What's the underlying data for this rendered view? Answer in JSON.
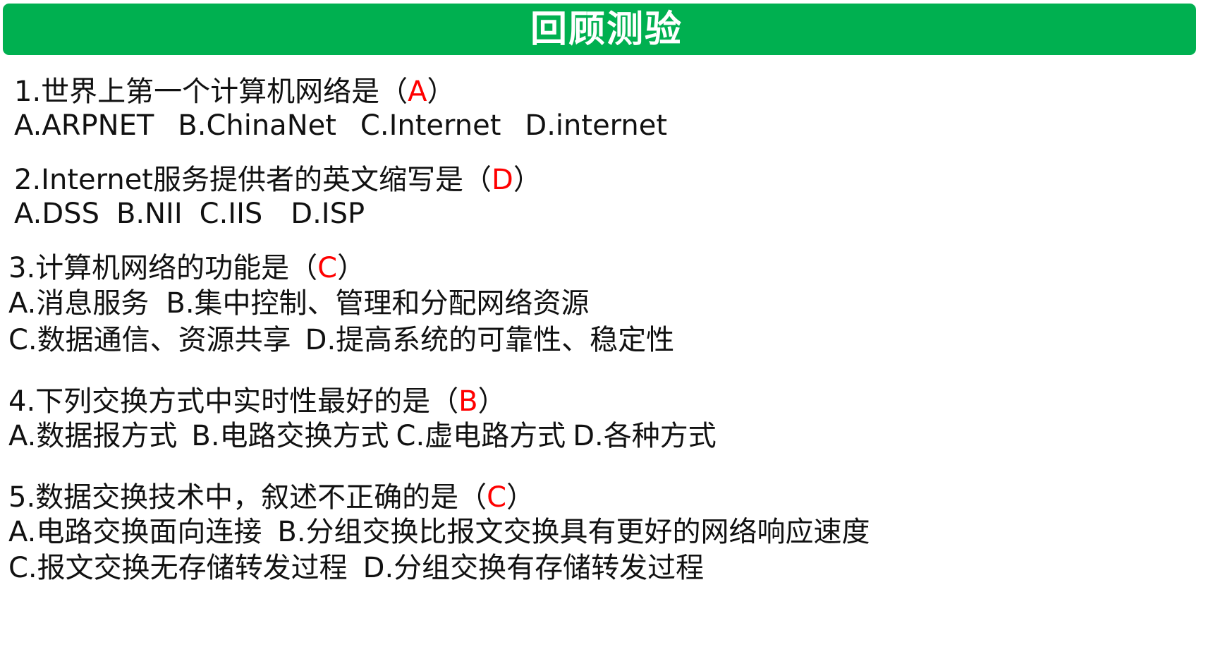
{
  "title": "回顾测验",
  "colors": {
    "header_bg": "#00b050",
    "header_text": "#ffffff",
    "answer": "#ff0000",
    "body_text": "#111111"
  },
  "questions": [
    {
      "stem": "1.世界上第一个计算机网络是（",
      "answer": "A",
      "close": "）",
      "options": [
        "A.ARPNET",
        "B.ChinaNet",
        "C.Internet",
        "D.internet"
      ]
    },
    {
      "stem": "2.Internet服务提供者的英文缩写是（",
      "answer": "D",
      "close": "）",
      "options": [
        "A.DSS",
        "B.NII",
        "C.IIS",
        "D.ISP"
      ]
    },
    {
      "stem": "3.计算机网络的功能是（",
      "answer": "C",
      "close": "）",
      "options": [
        "A.消息服务",
        "B.集中控制、管理和分配网络资源",
        "C.数据通信、资源共享",
        "D.提高系统的可靠性、稳定性"
      ]
    },
    {
      "stem": "4.下列交换方式中实时性最好的是（",
      "answer": "B",
      "close": "）",
      "options": [
        "A.数据报方式",
        "B.电路交换方式",
        "C.虚电路方式",
        "D.各种方式"
      ]
    },
    {
      "stem": "5.数据交换技术中，叙述不正确的是（",
      "answer": "C",
      "close": "）",
      "options": [
        "A.电路交换面向连接",
        "B.分组交换比报文交换具有更好的网络响应速度",
        "C.报文交换无存储转发过程",
        "D.分组交换有存储转发过程"
      ]
    }
  ]
}
